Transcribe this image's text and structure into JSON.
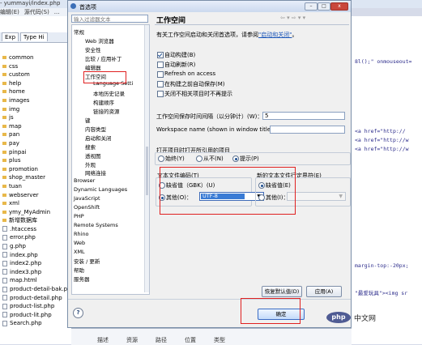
{
  "ide": {
    "title": "- yummayi/index.php",
    "menu": [
      "编辑(E)",
      "源代码(S)",
      "..."
    ],
    "tabs": [
      "Exp",
      "Type Hi"
    ],
    "tree": [
      {
        "label": "common",
        "type": "folder"
      },
      {
        "label": "css",
        "type": "folder"
      },
      {
        "label": "custom",
        "type": "folder"
      },
      {
        "label": "help",
        "type": "folder"
      },
      {
        "label": "home",
        "type": "folder"
      },
      {
        "label": "images",
        "type": "folder"
      },
      {
        "label": "img",
        "type": "folder"
      },
      {
        "label": "js",
        "type": "folder"
      },
      {
        "label": "map",
        "type": "folder"
      },
      {
        "label": "pan",
        "type": "folder"
      },
      {
        "label": "pay",
        "type": "folder"
      },
      {
        "label": "pinpai",
        "type": "folder"
      },
      {
        "label": "plus",
        "type": "folder"
      },
      {
        "label": "promotion",
        "type": "folder"
      },
      {
        "label": "shop_master",
        "type": "folder"
      },
      {
        "label": "tuan",
        "type": "folder"
      },
      {
        "label": "webserver",
        "type": "folder"
      },
      {
        "label": "xml",
        "type": "folder"
      },
      {
        "label": "ymy_MyAdmin",
        "type": "folder"
      },
      {
        "label": "新增数据库",
        "type": "folder"
      },
      {
        "label": ".htaccess",
        "type": "file"
      },
      {
        "label": "error.php",
        "type": "file"
      },
      {
        "label": "g.php",
        "type": "file"
      },
      {
        "label": "index.php",
        "type": "file"
      },
      {
        "label": "index2.php",
        "type": "file"
      },
      {
        "label": "index3.php",
        "type": "file"
      },
      {
        "label": "map.html",
        "type": "file"
      },
      {
        "label": "product-detail-bak.p",
        "type": "file"
      },
      {
        "label": "product-detail.php",
        "type": "file"
      },
      {
        "label": "product-list.php",
        "type": "file"
      },
      {
        "label": "product-lit.php",
        "type": "file"
      },
      {
        "label": "Search.php",
        "type": "file"
      }
    ],
    "code": [
      "8l();\" onmouseout=",
      "<a href=\"http://",
      "<a href=\"http://w",
      "<a href=\"http://w",
      "margin-top:-20px;",
      "\"最爱玩具\"><img sr"
    ],
    "bottom_columns": [
      "描述",
      "资源",
      "路径",
      "位置",
      "类型"
    ]
  },
  "dialog": {
    "title": "首选项",
    "window_buttons": [
      "–",
      "□",
      "x"
    ],
    "filter_placeholder": "输入过滤器文本",
    "nav": [
      {
        "label": "常规",
        "level": 0
      },
      {
        "label": "Web 浏览器",
        "level": 1
      },
      {
        "label": "安全性",
        "level": 1
      },
      {
        "label": "比较 / 应用补丁",
        "level": 1
      },
      {
        "label": "编辑器",
        "level": 1
      },
      {
        "label": "工作空间",
        "level": 1
      },
      {
        "label": "Language Setti",
        "level": 2
      },
      {
        "label": "本地历史记录",
        "level": 2
      },
      {
        "label": "构建顺序",
        "level": 2
      },
      {
        "label": "链接的资源",
        "level": 2
      },
      {
        "label": "键",
        "level": 1
      },
      {
        "label": "内容类型",
        "level": 1
      },
      {
        "label": "启动和关闭",
        "level": 1
      },
      {
        "label": "搜索",
        "level": 1
      },
      {
        "label": "透视图",
        "level": 1
      },
      {
        "label": "外观",
        "level": 1
      },
      {
        "label": "网络连接",
        "level": 1
      },
      {
        "label": "Browser",
        "level": 0
      },
      {
        "label": "Dynamic Languages",
        "level": 0
      },
      {
        "label": "JavaScript",
        "level": 0
      },
      {
        "label": "OpenShift",
        "level": 0
      },
      {
        "label": "PHP",
        "level": 0
      },
      {
        "label": "Remote Systems",
        "level": 0
      },
      {
        "label": "Rhino",
        "level": 0
      },
      {
        "label": "Web",
        "level": 0
      },
      {
        "label": "XML",
        "level": 0
      },
      {
        "label": "安装 / 更新",
        "level": 0
      },
      {
        "label": "帮助",
        "level": 0
      },
      {
        "label": "服务器",
        "level": 0
      }
    ],
    "panel": {
      "title": "工作空间",
      "nav_arrows": "⇦ ▾ ⇨ ▾ ▾",
      "description": "有关工作空间启动和关闭首选项，请参阅",
      "description_link": "\"启动和关闭\"",
      "description_end": "。",
      "checkboxes": [
        {
          "label": "自动构建(B)",
          "checked": true
        },
        {
          "label": "自动刷新(R)",
          "checked": false
        },
        {
          "label": "Refresh on access",
          "checked": false
        },
        {
          "label": "在构建之前自动保存(M)",
          "checked": false
        },
        {
          "label": "关闭不相关项目时不再提示",
          "checked": false
        }
      ],
      "save_interval_label": "工作空间保存时间间隔（以分钟计）(W)：",
      "save_interval_value": "5",
      "workspace_name_label": "Workspace name (shown in window title):",
      "workspace_name_value": "",
      "open_projects_label": "打开项目时打开所引用的项目",
      "open_projects_options": [
        {
          "label": "始终(Y)",
          "selected": false
        },
        {
          "label": "从不(N)",
          "selected": false
        },
        {
          "label": "提示(P)",
          "selected": true
        }
      ],
      "encoding_group_label": "文本文件编码(T)",
      "encoding_default_label": "缺省值（GBK）(U)",
      "encoding_other_label": "其他(O)：",
      "encoding_value": "UTF-8",
      "encoding_selected": "other",
      "eol_group_label": "新的文本文件行定界符(E)",
      "eol_default_label": "缺省值(E)",
      "eol_other_label": "其他(I)：",
      "eol_value": "",
      "eol_selected": "default"
    },
    "buttons": {
      "restore_defaults": "恢复默认值(D)",
      "apply": "应用(A)",
      "ok": "确定"
    },
    "help_icon": "?"
  },
  "watermark": {
    "logo": "php",
    "site": "中文网"
  },
  "colors": {
    "annotation": "#e02020",
    "selection": "#3a7bd5",
    "link": "#1a55b8"
  }
}
